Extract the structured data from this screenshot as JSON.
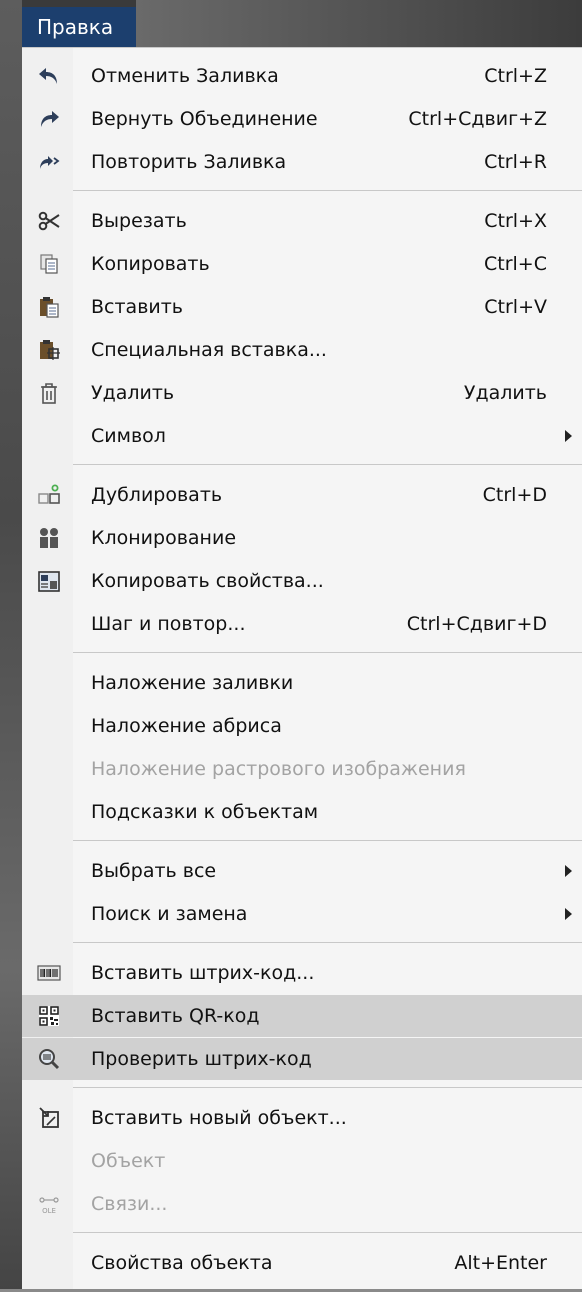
{
  "menu_title": "Правка",
  "items": [
    {
      "label": "Отменить Заливка",
      "shortcut": "Ctrl+Z",
      "icon": "undo-icon"
    },
    {
      "label": "Вернуть Объединение",
      "shortcut": "Ctrl+Сдвиг+Z",
      "icon": "redo-icon"
    },
    {
      "label": "Повторить Заливка",
      "shortcut": "Ctrl+R",
      "icon": "repeat-icon"
    },
    {
      "label": "Вырезать",
      "shortcut": "Ctrl+X",
      "icon": "scissors-icon"
    },
    {
      "label": "Копировать",
      "shortcut": "Ctrl+C",
      "icon": "copy-icon"
    },
    {
      "label": "Вставить",
      "shortcut": "Ctrl+V",
      "icon": "paste-icon"
    },
    {
      "label": "Специальная вставка...",
      "shortcut": "",
      "icon": "paste-special-icon"
    },
    {
      "label": "Удалить",
      "shortcut": "Удалить",
      "icon": "trash-icon"
    },
    {
      "label": "Символ",
      "shortcut": "",
      "icon": "",
      "submenu": true
    },
    {
      "label": "Дублировать",
      "shortcut": "Ctrl+D",
      "icon": "duplicate-icon"
    },
    {
      "label": "Клонирование",
      "shortcut": "",
      "icon": "clone-icon"
    },
    {
      "label": "Копировать свойства...",
      "shortcut": "",
      "icon": "copy-properties-icon"
    },
    {
      "label": "Шаг и повтор...",
      "shortcut": "Ctrl+Сдвиг+D",
      "icon": ""
    },
    {
      "label": "Наложение заливки",
      "shortcut": "",
      "icon": ""
    },
    {
      "label": "Наложение абриса",
      "shortcut": "",
      "icon": ""
    },
    {
      "label": "Наложение растрового изображения",
      "shortcut": "",
      "icon": "",
      "disabled": true
    },
    {
      "label": "Подсказки к объектам",
      "shortcut": "",
      "icon": ""
    },
    {
      "label": "Выбрать все",
      "shortcut": "",
      "icon": "",
      "submenu": true
    },
    {
      "label": "Поиск и замена",
      "shortcut": "",
      "icon": "",
      "submenu": true
    },
    {
      "label": "Вставить штрих-код...",
      "shortcut": "",
      "icon": "barcode-icon"
    },
    {
      "label": "Вставить QR-код",
      "shortcut": "",
      "icon": "qr-code-icon",
      "highlighted": true
    },
    {
      "label": "Проверить штрих-код",
      "shortcut": "",
      "icon": "validate-barcode-icon",
      "highlighted": true
    },
    {
      "label": "Вставить новый объект...",
      "shortcut": "",
      "icon": "insert-object-icon"
    },
    {
      "label": "Объект",
      "shortcut": "",
      "icon": "",
      "disabled": true
    },
    {
      "label": "Связи...",
      "shortcut": "",
      "icon": "ole-links-icon",
      "disabled": true
    },
    {
      "label": "Свойства объекта",
      "shortcut": "Alt+Enter",
      "icon": ""
    }
  ],
  "icon_text": {
    "ole": "OLE"
  },
  "colors": {
    "menu_title_bg": "#1c3f6e",
    "highlight_bg": "#d0d0d0",
    "disabled_text": "#a3a3a3"
  }
}
